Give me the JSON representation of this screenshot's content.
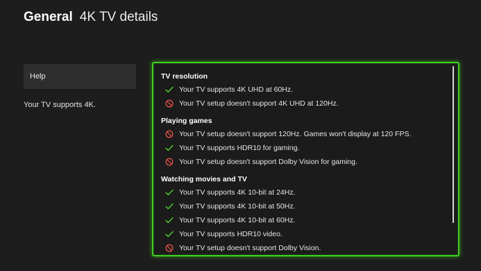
{
  "header": {
    "section": "General",
    "page": "4K TV details"
  },
  "sidebar": {
    "help_label": "Help",
    "help_text": "Your TV supports 4K."
  },
  "colors": {
    "accent_green": "#3fd024",
    "check_green": "#4fd12e",
    "block_red": "#e5504a"
  },
  "groups": [
    {
      "title": "TV resolution",
      "items": [
        {
          "status": "check-icon",
          "text": "Your TV supports 4K UHD at 60Hz."
        },
        {
          "status": "blocked-icon",
          "text": "Your TV setup doesn't support 4K UHD at 120Hz."
        }
      ]
    },
    {
      "title": "Playing games",
      "items": [
        {
          "status": "blocked-icon",
          "text": "Your TV setup doesn't support 120Hz. Games won't display at 120 FPS."
        },
        {
          "status": "check-icon",
          "text": "Your TV supports HDR10 for gaming."
        },
        {
          "status": "blocked-icon",
          "text": "Your TV setup doesn't support Dolby Vision for gaming."
        }
      ]
    },
    {
      "title": "Watching movies and TV",
      "items": [
        {
          "status": "check-icon",
          "text": "Your TV supports 4K 10-bit at 24Hz."
        },
        {
          "status": "check-icon",
          "text": "Your TV supports 4K 10-bit at 50Hz."
        },
        {
          "status": "check-icon",
          "text": "Your TV supports 4K 10-bit at 60Hz."
        },
        {
          "status": "check-icon",
          "text": "Your TV supports HDR10 video."
        },
        {
          "status": "blocked-icon",
          "text": "Your TV setup doesn't support Dolby Vision."
        }
      ]
    }
  ]
}
